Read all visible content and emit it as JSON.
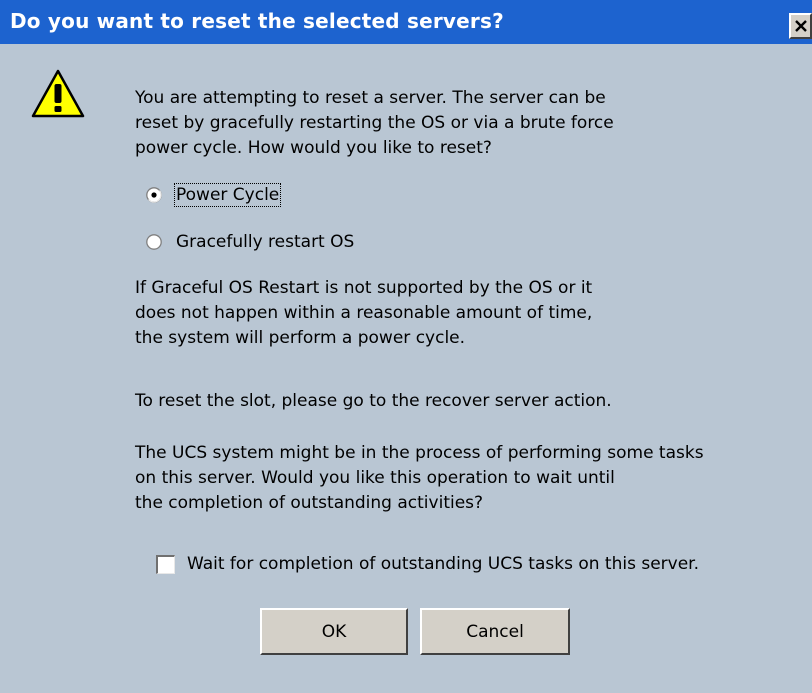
{
  "dialog": {
    "title": "Do you want to reset the selected servers?",
    "intro_lines": [
      "You are attempting to reset a server. The server can be",
      "reset by gracefully restarting the OS or via a brute force",
      "power cycle. How would you like to reset?"
    ],
    "options": [
      {
        "label": "Power Cycle",
        "selected": true
      },
      {
        "label": "Gracefully restart OS",
        "selected": false
      }
    ],
    "graceful_note_lines": [
      "If Graceful OS Restart is not supported by the OS or it",
      "does not happen within a reasonable amount of time,",
      "the system will perform a power cycle."
    ],
    "slot_note": "To reset the slot, please go to the recover server action.",
    "ucs_note_lines": [
      "The UCS system might be in the process of performing some tasks",
      "on this server. Would you like this operation to wait until",
      "the completion of outstanding activities?"
    ],
    "wait_checkbox": {
      "label": "Wait for completion of outstanding UCS tasks on this server.",
      "checked": false
    },
    "ok_label": "OK",
    "cancel_label": "Cancel"
  },
  "icons": {
    "warning": "warning-icon",
    "close": "close-icon"
  },
  "colors": {
    "titlebar": "#1d63cf",
    "background": "#b9c6d3",
    "warning_yellow": "#ffff00"
  }
}
